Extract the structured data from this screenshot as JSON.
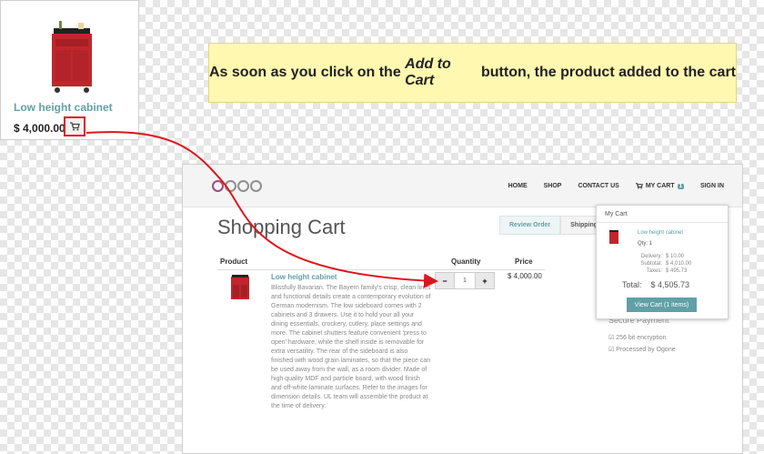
{
  "card": {
    "product_name": "Low height cabinet",
    "price": "$ 4,000.00"
  },
  "callout": {
    "before": "As soon as you click on the ",
    "emphasis": "Add to Cart",
    "after": " button, the product added to the cart"
  },
  "site": {
    "nav": [
      "HOME",
      "SHOP",
      "CONTACT US"
    ],
    "cart_label": "MY CART",
    "cart_count": "1",
    "sign_in": "SIGN IN",
    "page_title": "Shopping Cart",
    "steps": [
      "Review Order",
      "Shipping &"
    ],
    "columns": {
      "product": "Product",
      "quantity": "Quantity",
      "price": "Price"
    },
    "row": {
      "name": "Low height cabinet",
      "description": "Blissfully Bavarian. The Bayern family's crisp, clean lines and functional details create a contemporary evolution of German modernism. The low sideboard comes with 2 cabinets and 3 drawers. Use it to hold your all your dining essentials, crockery, cutlery, place settings and more. The cabinet shutters feature convenient 'press to open' hardware, while the shelf inside is removable for extra versatility. The rear of the sideboard is also finished with wood grain laminates, so that the piece can be used away from the wall, as a room divider. Made of high quality MDF and particle board, with wood finish and off-white laminate surfaces. Refer to the images for dimension details. UL team will assemble the product at the time of delivery.",
      "quantity": "1",
      "price": "$ 4,000.00"
    },
    "secure_title": "Secure Payment",
    "secure_items": [
      "256 bit encryption",
      "Processed by Ogone"
    ],
    "minicart": {
      "title": "My Cart",
      "item_name": "Low height cabinet",
      "qty": "Qty: 1",
      "lines": [
        {
          "label": "Delivery:",
          "value": "$ 10.00"
        },
        {
          "label": "Subtotal:",
          "value": "$ 4,010.00"
        },
        {
          "label": "Taxes:",
          "value": "$ 495.73"
        }
      ],
      "total_label": "Total:",
      "total_value": "$ 4,505.73",
      "button": "View Cart (1 items)"
    }
  },
  "colors": {
    "accent": "#62a0a7",
    "highlight": "#e0141c",
    "callout_bg": "#fff8b0",
    "product_red": "#c0262c"
  },
  "icons": [
    "cart-icon",
    "cabinet-image"
  ]
}
